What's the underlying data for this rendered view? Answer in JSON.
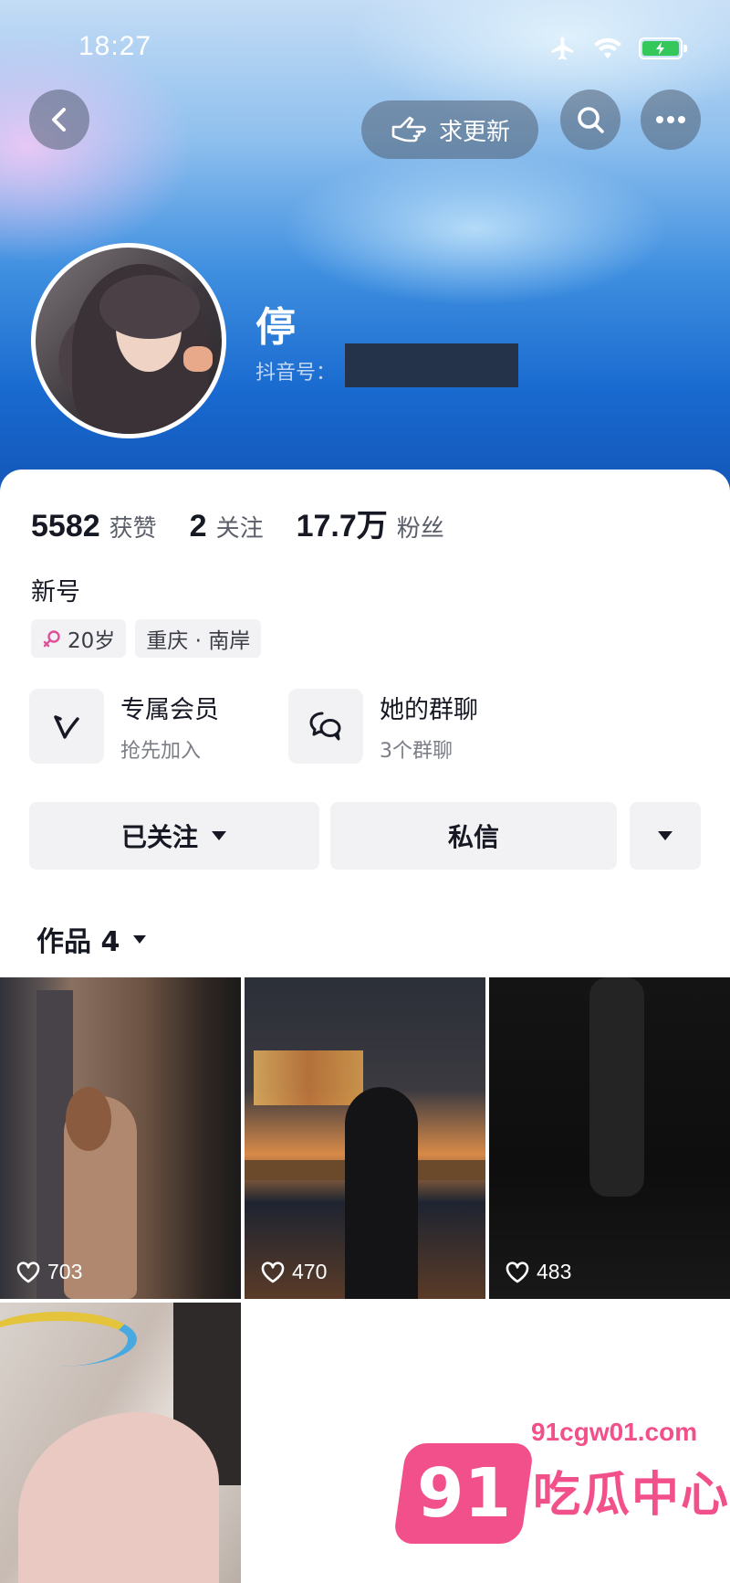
{
  "status_bar": {
    "time": "18:27",
    "icons": [
      "airplane-icon",
      "wifi-icon",
      "battery-charging-icon"
    ]
  },
  "nav": {
    "update_request_label": "求更新",
    "icons": [
      "back-icon",
      "pointing-hand-icon",
      "search-icon",
      "more-icon"
    ]
  },
  "profile": {
    "nickname": "停",
    "douyin_id_label": "抖音号："
  },
  "stats": [
    {
      "value": "5582",
      "label": "获赞"
    },
    {
      "value": "2",
      "label": "关注"
    },
    {
      "value": "17.7万",
      "label": "粉丝"
    }
  ],
  "bio": "新号",
  "tags": [
    {
      "icon": "female-icon",
      "text": "20岁"
    },
    {
      "text": "重庆 · 南岸"
    }
  ],
  "features": [
    {
      "icon": "vip-icon",
      "title": "专属会员",
      "subtitle": "抢先加入"
    },
    {
      "icon": "group-chat-icon",
      "title": "她的群聊",
      "subtitle": "3个群聊"
    }
  ],
  "actions": {
    "followed_label": "已关注",
    "message_label": "私信"
  },
  "works": {
    "title": "作品 4",
    "items": [
      {
        "likes": "703"
      },
      {
        "likes": "470"
      },
      {
        "likes": "483"
      },
      {
        "likes": ""
      }
    ]
  },
  "watermark": {
    "number": "91",
    "url": "91cgw01.com",
    "text": "吃瓜中心"
  },
  "colors": {
    "accent_pink": "#f2508a",
    "header_blue": "#1869cf",
    "button_gray": "#f2f2f4"
  }
}
